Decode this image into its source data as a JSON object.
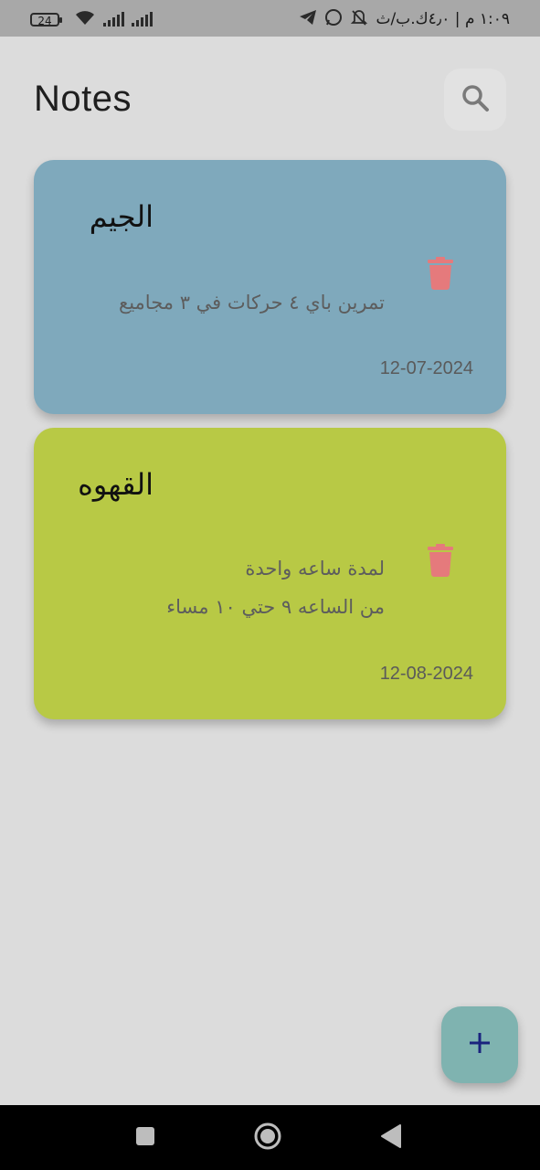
{
  "status_bar": {
    "battery": "24",
    "time_text": "١:٠٩ م | ٤٫٠ك.ب/ث"
  },
  "header": {
    "title": "Notes",
    "search_icon": "search-icon"
  },
  "notes": [
    {
      "title": "الجيم",
      "body_lines": [
        "تمرين باي ٤ حركات في ٣ مجاميع"
      ],
      "date": "12-07-2024",
      "color": "#7fa9bc"
    },
    {
      "title": "القهوه",
      "body_lines": [
        "لمدة ساعه واحدة",
        "من الساعه ٩ حتي ١٠ مساء"
      ],
      "date": "12-08-2024",
      "color": "#b8c945"
    }
  ],
  "colors": {
    "background": "#dcdcdc",
    "delete_icon": "#e57a7c",
    "fab": "#7fb3b0",
    "fab_icon": "#1a237e"
  },
  "fab": {
    "icon": "plus-icon"
  },
  "nav_bar": {
    "icons": [
      "square-recents-icon",
      "circle-home-icon",
      "triangle-back-icon"
    ]
  }
}
